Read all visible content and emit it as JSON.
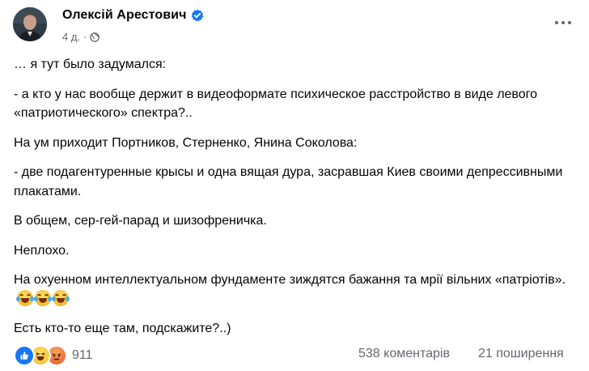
{
  "post": {
    "author": "Олексій Арестович",
    "time": "4 д.",
    "separator": "·",
    "privacy_icon": "globe-icon",
    "verified_icon": "verified-badge-icon",
    "more_icon": "more-options-icon"
  },
  "content": {
    "lines": [
      "… я тут было задумался:",
      "- а кто у нас вообще держит в видеоформате психическое расстройство в виде левого «патриотического» спектра?..",
      "На ум приходит Портников, Стерненко, Янина Соколова:",
      "- две подагентуренные крысы и одна вящая дура, засравшая Киев своими депрессивными плакатами.",
      "В общем, сер-гей-парад и шизофреничка.",
      "Неплохо.",
      "На охуенном интеллектуальном фундаменте зиждятся бажання та мрії вільних «патріотів».",
      "Есть кто-то еще там, подскажите?..)"
    ],
    "emojis": [
      "laughing-tears-emoji",
      "laughing-tears-emoji",
      "laughing-tears-emoji"
    ]
  },
  "footer": {
    "reactions": [
      "like-reaction-icon",
      "haha-reaction-icon",
      "angry-reaction-icon"
    ],
    "reaction_count": "911",
    "comments": "538 коментарів",
    "shares": "21 поширення"
  },
  "colors": {
    "text": "#050505",
    "secondary": "#65676b",
    "brand_blue": "#1877f2"
  }
}
